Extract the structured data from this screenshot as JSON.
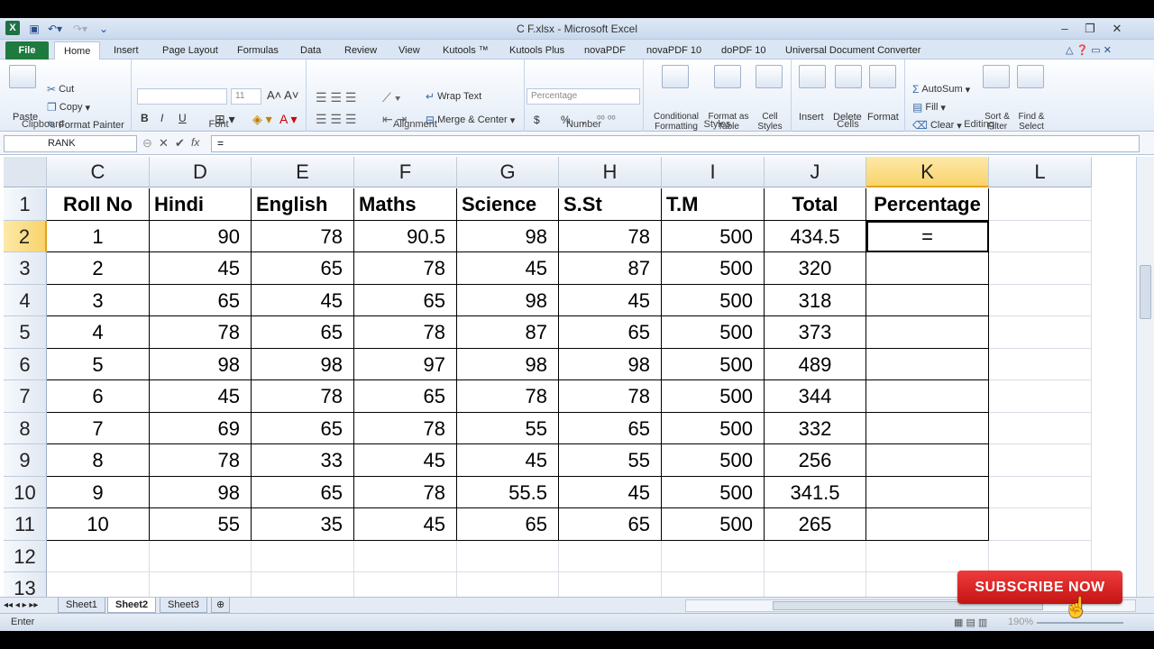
{
  "window": {
    "title": "C F.xlsx  -  Microsoft Excel",
    "app_logo": "X"
  },
  "menu": {
    "file": "File",
    "tabs": [
      "Home",
      "Insert",
      "Page Layout",
      "Formulas",
      "Data",
      "Review",
      "View",
      "Kutools ™",
      "Kutools Plus",
      "novaPDF",
      "novaPDF 10",
      "doPDF 10",
      "Universal Document Converter"
    ]
  },
  "ribbon": {
    "clipboard": {
      "label": "Clipboard",
      "paste": "Paste",
      "cut": "Cut",
      "copy": "Copy",
      "format_painter": "Format Painter"
    },
    "font": {
      "label": "Font",
      "size": "11",
      "bold": "B",
      "italic": "I",
      "underline": "U"
    },
    "alignment": {
      "label": "Alignment",
      "wrap_text": "Wrap Text",
      "merge_center": "Merge & Center"
    },
    "number": {
      "label": "Number",
      "format": "Percentage",
      "currency": "$",
      "percent": "%",
      "comma": ","
    },
    "styles": {
      "label": "Styles",
      "conditional": "Conditional Formatting",
      "format_table": "Format as Table",
      "cell_styles": "Cell Styles"
    },
    "cells": {
      "label": "Cells",
      "insert": "Insert",
      "delete": "Delete",
      "format": "Format"
    },
    "editing": {
      "label": "Editing",
      "autosum": "AutoSum",
      "fill": "Fill",
      "clear": "Clear",
      "sort_filter": "Sort & Filter",
      "find_select": "Find & Select"
    }
  },
  "formula_bar": {
    "name_box": "RANK",
    "fx": "fx",
    "content": "="
  },
  "columns": [
    "C",
    "D",
    "E",
    "F",
    "G",
    "H",
    "I",
    "J",
    "K",
    "L"
  ],
  "rows": [
    "1",
    "2",
    "3",
    "4",
    "5",
    "6",
    "7",
    "8",
    "9",
    "10",
    "11",
    "12",
    "13"
  ],
  "table": {
    "headers": [
      "Roll No",
      "Hindi",
      "English",
      "Maths",
      "Science",
      "S.St",
      "T.M",
      "Total",
      "Percentage"
    ],
    "data": [
      [
        "1",
        "90",
        "78",
        "90.5",
        "98",
        "78",
        "500",
        "434.5",
        "="
      ],
      [
        "2",
        "45",
        "65",
        "78",
        "45",
        "87",
        "500",
        "320",
        ""
      ],
      [
        "3",
        "65",
        "45",
        "65",
        "98",
        "45",
        "500",
        "318",
        ""
      ],
      [
        "4",
        "78",
        "65",
        "78",
        "87",
        "65",
        "500",
        "373",
        ""
      ],
      [
        "5",
        "98",
        "98",
        "97",
        "98",
        "98",
        "500",
        "489",
        ""
      ],
      [
        "6",
        "45",
        "78",
        "65",
        "78",
        "78",
        "500",
        "344",
        ""
      ],
      [
        "7",
        "69",
        "65",
        "78",
        "55",
        "65",
        "500",
        "332",
        ""
      ],
      [
        "8",
        "78",
        "33",
        "45",
        "45",
        "55",
        "500",
        "256",
        ""
      ],
      [
        "9",
        "98",
        "65",
        "78",
        "55.5",
        "45",
        "500",
        "341.5",
        ""
      ],
      [
        "10",
        "55",
        "35",
        "45",
        "65",
        "65",
        "500",
        "265",
        ""
      ]
    ]
  },
  "sheets": [
    "Sheet1",
    "Sheet2",
    "Sheet3"
  ],
  "active_sheet": "Sheet2",
  "status": {
    "mode": "Enter",
    "zoom": "190%"
  },
  "overlay": {
    "subscribe": "SUBSCRIBE NOW"
  }
}
